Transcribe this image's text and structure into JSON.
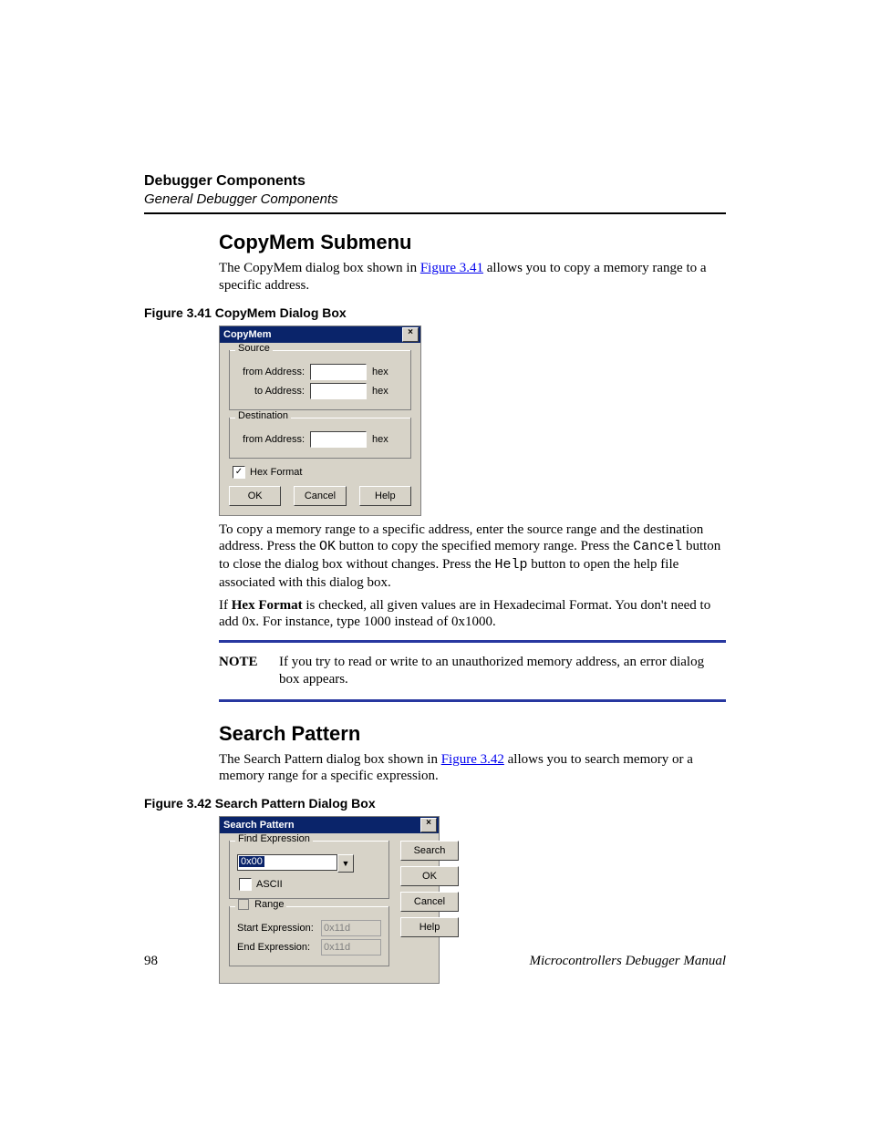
{
  "header": {
    "title": "Debugger Components",
    "subtitle": "General Debugger Components"
  },
  "section1": {
    "heading": "CopyMem Submenu",
    "intro_a": "The CopyMem dialog box shown in ",
    "intro_link": "Figure 3.41",
    "intro_b": " allows you to copy a memory range to a specific address.",
    "figcap": "Figure 3.41  CopyMem Dialog Box",
    "dlg": {
      "title": "CopyMem",
      "source": {
        "legend": "Source",
        "from_label": "from Address:",
        "to_label": "to Address:",
        "hex": "hex"
      },
      "dest": {
        "legend": "Destination",
        "from_label": "from Address:",
        "hex": "hex"
      },
      "hexfmt": "Hex Format",
      "hexfmt_checked": "✓",
      "ok": "OK",
      "cancel": "Cancel",
      "help": "Help"
    },
    "para2_a": "To copy a memory range to a specific address, enter the source range and the destination address. Press the ",
    "para2_ok": "OK",
    "para2_b": " button to copy the specified memory range. Press the ",
    "para2_cancel": "Cancel",
    "para2_c": " button to close the dialog box without changes. Press the ",
    "para2_help": "Help",
    "para2_d": " button to open the help file associated with this dialog box.",
    "para3_a": "If ",
    "para3_bold": "Hex Format",
    "para3_b": " is checked, all given values are in Hexadecimal Format. You don't need to add 0x. For instance, type 1000 instead of 0x1000.",
    "note_label": "NOTE",
    "note_text": "If you try to read or write to an unauthorized memory address, an error dialog box appears."
  },
  "section2": {
    "heading": "Search Pattern",
    "intro_a": "The Search Pattern dialog box shown in ",
    "intro_link": "Figure 3.42",
    "intro_b": " allows you to search memory or a memory range for a specific expression.",
    "figcap": "Figure 3.42  Search Pattern Dialog Box",
    "dlg": {
      "title": "Search Pattern",
      "findexp": {
        "legend": "Find Expression",
        "value": "0x00",
        "ascii": "ASCII"
      },
      "range": {
        "legend": "Range",
        "start_label": "Start Expression:",
        "end_label": "End Expression:",
        "start_value": "0x11d",
        "end_value": "0x11d"
      },
      "search": "Search",
      "ok": "OK",
      "cancel": "Cancel",
      "help": "Help"
    }
  },
  "footer": {
    "page": "98",
    "manual": "Microcontrollers Debugger Manual"
  }
}
